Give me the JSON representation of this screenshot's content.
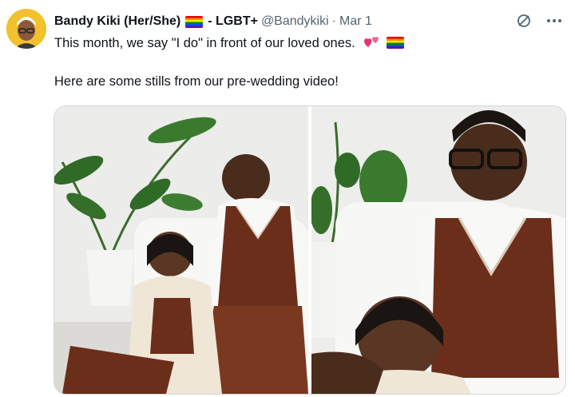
{
  "tweet": {
    "author_name": "Bandy Kiki (Her/She)",
    "author_suffix": "- LGBT+",
    "handle": "@Bandykiki",
    "separator": "·",
    "date": "Mar 1",
    "line1": "This month, we say \"I do\" in front of our loved ones.",
    "line2": "Here are some stills from our pre-wedding video!",
    "emoji": [
      "two-hearts",
      "rainbow-flag"
    ]
  },
  "icons": {
    "avatar": "avatar",
    "rainbow_flag": "rainbow-flag-icon",
    "grok": "grok-icon",
    "more": "more-icon"
  },
  "colors": {
    "avatar_bg": "#f2c12e",
    "secondary_text": "#536471",
    "sweater_brown": "#6b2e1a"
  },
  "media": {
    "count": 2,
    "photos": [
      "pre-wedding-still-1",
      "pre-wedding-still-2"
    ]
  }
}
